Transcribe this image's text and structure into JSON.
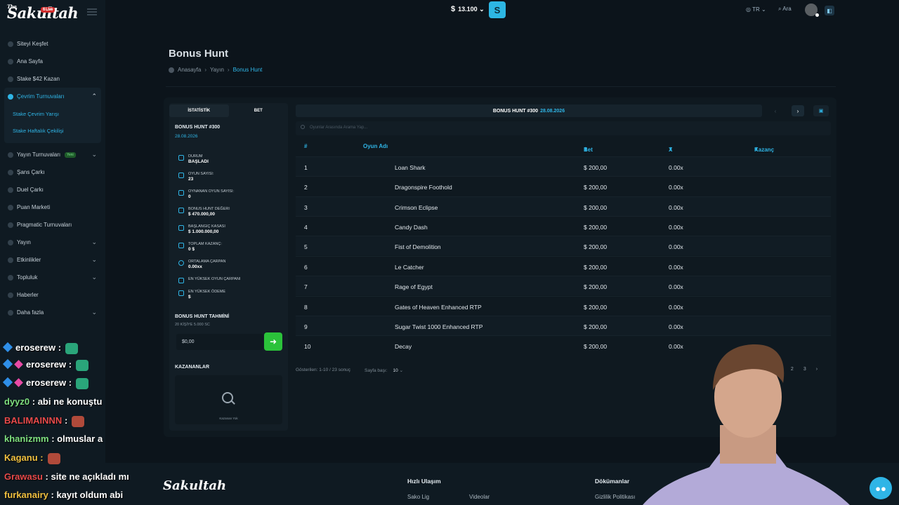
{
  "brand": {
    "logo_small": "The",
    "logo": "Sakultah",
    "live_badge": "6 Live"
  },
  "topbar": {
    "currency_symbol": "$",
    "balance": "13.100",
    "language": "TR",
    "search_label": "Ara"
  },
  "sidebar": {
    "items": [
      {
        "label": "Siteyi Keşfet"
      },
      {
        "label": "Ana Sayfa"
      },
      {
        "label": "Stake $42 Kazan"
      }
    ],
    "group": {
      "label": "Çevrim Turnuvaları",
      "children": [
        {
          "label": "Stake Çevrim Yarışı"
        },
        {
          "label": "Stake Haftalık Çekilişi"
        }
      ]
    },
    "items2": [
      {
        "label": "Yayın Turnuvaları",
        "badge": "Yeni"
      },
      {
        "label": "Şans Çarkı"
      },
      {
        "label": "Duel Çarkı"
      },
      {
        "label": "Puan Marketi"
      },
      {
        "label": "Pragmatic Turnuvaları"
      },
      {
        "label": "Yayın"
      },
      {
        "label": "Etkinlikler"
      },
      {
        "label": "Topluluk"
      },
      {
        "label": "Haberler"
      },
      {
        "label": "Daha fazla"
      }
    ]
  },
  "page": {
    "title": "Bonus Hunt",
    "breadcrumb": [
      "Anasayfa",
      "Yayın",
      "Bonus Hunt"
    ]
  },
  "stats_panel": {
    "tabs": [
      "İSTATİSTİK",
      "BET"
    ],
    "hunt_name": "BONUS HUNT #300",
    "hunt_date": "28.08.2026",
    "stats": [
      {
        "label": "Durum",
        "value": "BAŞLADI"
      },
      {
        "label": "Oyun Sayısı:",
        "value": "23"
      },
      {
        "label": "Oynanan Oyun Sayısı:",
        "value": "0"
      },
      {
        "label": "Bonus Hunt Değeri",
        "value": "$ 470.000,00"
      },
      {
        "label": "Başlangıç Kasası",
        "value": "$ 1.000.000,00"
      },
      {
        "label": "Toplam Kazanç:",
        "value": "0 $"
      },
      {
        "label": "Ortalama Çarpan",
        "value": "0.00xx"
      },
      {
        "label": "En Yüksek Oyun Çarpanı",
        "value": ""
      },
      {
        "label": "En Yüksek Ödeme",
        "value": "$"
      }
    ],
    "guess_title": "BONUS HUNT TAHMİNİ",
    "guess_sub": "20 KİŞİYE 5.000 SC",
    "guess_value": "$0,00",
    "winners_title": "KAZANANLAR",
    "winners_empty": "Kazanan Yok"
  },
  "table": {
    "hunt_label": "BONUS HUNT #300",
    "hunt_date": "28.08.2026",
    "search_placeholder": "Oyunlar Arasında Arama Yap...",
    "columns": [
      "#",
      "Oyun Adı",
      "Bet",
      "X",
      "Kazanç"
    ],
    "rows": [
      {
        "n": "1",
        "game": "Loan Shark",
        "bet": "$ 200,00",
        "x": "0.00x"
      },
      {
        "n": "2",
        "game": "Dragonspire Foothold",
        "bet": "$ 200,00",
        "x": "0.00x"
      },
      {
        "n": "3",
        "game": "Crimson Eclipse",
        "bet": "$ 200,00",
        "x": "0.00x"
      },
      {
        "n": "4",
        "game": "Candy Dash",
        "bet": "$ 200,00",
        "x": "0.00x"
      },
      {
        "n": "5",
        "game": "Fist of Demolition",
        "bet": "$ 200,00",
        "x": "0.00x"
      },
      {
        "n": "6",
        "game": "Le Catcher",
        "bet": "$ 200,00",
        "x": "0.00x"
      },
      {
        "n": "7",
        "game": "Rage of Egypt",
        "bet": "$ 200,00",
        "x": "0.00x"
      },
      {
        "n": "8",
        "game": "Gates of Heaven Enhanced RTP",
        "bet": "$ 200,00",
        "x": "0.00x"
      },
      {
        "n": "9",
        "game": "Sugar Twist 1000 Enhanced RTP",
        "bet": "$ 200,00",
        "x": "0.00x"
      },
      {
        "n": "10",
        "game": "Decay",
        "bet": "$ 200,00",
        "x": "0.00x"
      }
    ],
    "showing": "Gösterilen: 1-10 / 23 sonuç",
    "page_size_label": "Sayfa başı:",
    "page_size": "10",
    "pages": [
      "1",
      "2",
      "3"
    ]
  },
  "footer": {
    "logo": "Sakultah",
    "heading_quick": "Hızlı Ulaşım",
    "heading_docs": "Dökümanlar",
    "links": [
      "Sako Lig",
      "Videolar",
      "Gizlilik Politikası"
    ]
  },
  "chat": [
    {
      "user": "eroserew :",
      "msg": ""
    },
    {
      "user": "eroserew :",
      "msg": ""
    },
    {
      "user": "eroserew :",
      "msg": ""
    },
    {
      "user": "dyyz0",
      "msg": ": abi ne konuştu"
    },
    {
      "user": "BALIMAINNN",
      "msg": ":"
    },
    {
      "user": "khanizmm",
      "msg": ": olmuslar a"
    },
    {
      "user": "Kaganu :",
      "msg": ""
    },
    {
      "user": "Grawasu",
      "msg": ": site ne açıkladı mı"
    },
    {
      "user": "furkanairy",
      "msg": ": kayıt oldum abi"
    }
  ],
  "colors": {
    "accent": "#2fb5e6",
    "bg": "#0c141b",
    "go": "#2bc23a"
  }
}
